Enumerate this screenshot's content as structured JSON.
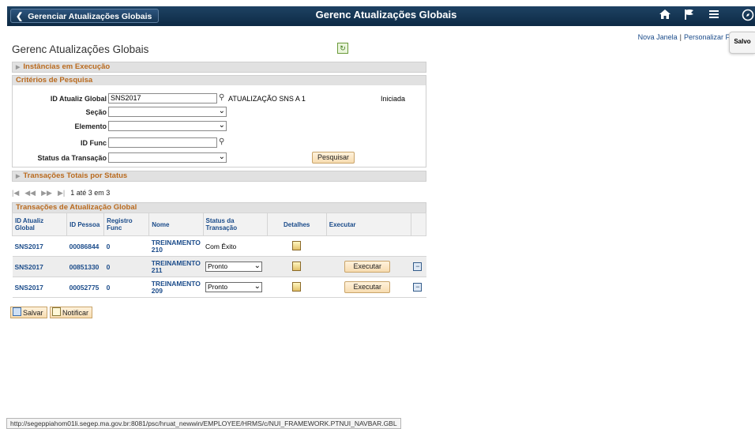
{
  "topbar": {
    "back_label": "Gerenciar Atualizações Globais",
    "title": "Gerenc Atualizações Globais",
    "icons": [
      "home-icon",
      "flag-icon",
      "menu-icon",
      "navbar-icon"
    ]
  },
  "links": {
    "new_window": "Nova Janela",
    "separator": "|",
    "personalize": "Personalizar F"
  },
  "saved_tab": "Salvo",
  "page_title": "Gerenc Atualizações Globais",
  "sections": {
    "instances": "Instâncias em Execução",
    "criteria": "Critérios de Pesquisa",
    "totals": "Transações Totais por Status"
  },
  "criteria": {
    "global_update_id": {
      "label": "ID Atualiz Global",
      "value": "SNS2017",
      "description": "ATUALIZAÇÃO SNS A 1",
      "status": "Iniciada"
    },
    "section": {
      "label": "Seção",
      "value": ""
    },
    "element": {
      "label": "Elemento",
      "value": ""
    },
    "employee_id": {
      "label": "ID Func",
      "value": ""
    },
    "transaction_status": {
      "label": "Status da Transação",
      "value": ""
    },
    "search_button": "Pesquisar"
  },
  "pager": {
    "count": "1 até 3 em 3"
  },
  "grid": {
    "title": "Transações de Atualização Global",
    "columns": [
      "ID Atualiz Global",
      "ID Pessoa",
      "Registro Func",
      "Nome",
      "Status da Transação",
      "Detalhes",
      "Executar"
    ],
    "rows": [
      {
        "global_id": "SNS2017",
        "person_id": "00086844",
        "record": "0",
        "name": "TREINAMENTO 210",
        "status": "Com Êxito",
        "execute": ""
      },
      {
        "global_id": "SNS2017",
        "person_id": "00851330",
        "record": "0",
        "name": "TREINAMENTO 211",
        "status": "Pronto",
        "execute": "Executar"
      },
      {
        "global_id": "SNS2017",
        "person_id": "00052775",
        "record": "0",
        "name": "TREINAMENTO 209",
        "status": "Pronto",
        "execute": "Executar"
      }
    ]
  },
  "buttons": {
    "save": "Salvar",
    "notify": "Notificar"
  },
  "status_url": "http://segeppiahom01li.segep.ma.gov.br:8081/psc/hruat_newwin/EMPLOYEE/HRMS/c/NUI_FRAMEWORK.PTNUI_NAVBAR.GBL"
}
